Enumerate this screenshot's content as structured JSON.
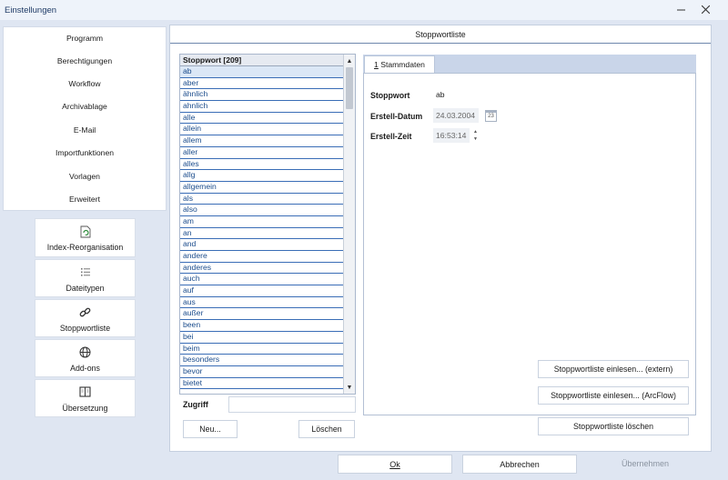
{
  "window": {
    "title": "Einstellungen"
  },
  "nav": {
    "items": [
      {
        "label": "Programm"
      },
      {
        "label": "Berechtigungen"
      },
      {
        "label": "Workflow"
      },
      {
        "label": "Archivablage"
      },
      {
        "label": "E-Mail"
      },
      {
        "label": "Importfunktionen"
      },
      {
        "label": "Vorlagen"
      },
      {
        "label": "Erweitert"
      }
    ]
  },
  "tiles": [
    {
      "label": "Index-Reorganisation",
      "icon": "reorganize-icon"
    },
    {
      "label": "Dateitypen",
      "icon": "list-icon"
    },
    {
      "label": "Stoppwortliste",
      "icon": "link-icon"
    },
    {
      "label": "Add-ons",
      "icon": "globe-icon"
    },
    {
      "label": "Übersetzung",
      "icon": "book-icon"
    }
  ],
  "content": {
    "title": "Stoppwortliste"
  },
  "list": {
    "header": "Stoppwort [209]",
    "items": [
      "ab",
      "aber",
      "ähnlich",
      "ahnlich",
      "alle",
      "allein",
      "allem",
      "aller",
      "alles",
      "allg",
      "allgemein",
      "als",
      "also",
      "am",
      "an",
      "and",
      "andere",
      "anderes",
      "auch",
      "auf",
      "aus",
      "außer",
      "been",
      "bei",
      "beim",
      "besonders",
      "bevor",
      "bietet"
    ]
  },
  "zugriff": {
    "label": "Zugriff",
    "value": ""
  },
  "buttons": {
    "new": "Neu...",
    "delete": "Löschen",
    "import_extern": "Stoppwortliste einlesen... (extern)",
    "import_arcflow": "Stoppwortliste einlesen... (ArcFlow)",
    "delete_list": "Stoppwortliste löschen"
  },
  "tab": {
    "number": "1",
    "label": "Stammdaten"
  },
  "form": {
    "stoppwort_label": "Stoppwort",
    "stoppwort_value": "ab",
    "datum_label": "Erstell-Datum",
    "datum_value": "24.03.2004",
    "calendar_day": "23",
    "zeit_label": "Erstell-Zeit",
    "zeit_value": "16:53:14"
  },
  "footer": {
    "ok": "Ok",
    "cancel": "Abbrechen",
    "apply": "Übernehmen"
  },
  "colors": {
    "accent": "#1b4c8c",
    "background": "#dfe6f2"
  }
}
